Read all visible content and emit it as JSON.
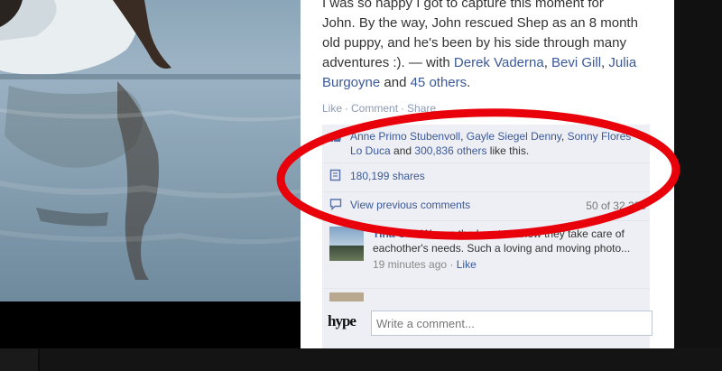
{
  "caption": {
    "line1": "I was so happy I got to capture this moment for",
    "line2": "John. By the way, John rescued Shep as an 8 month",
    "line3": "old puppy, and he's been by his side through many",
    "line4_text": "adventures :). — with ",
    "tag1": "Derek Vaderna",
    "sep1": ", ",
    "tag2": "Bevi Gill",
    "sep2": ", ",
    "tag3": "Julia Burgoyne",
    "and": " and ",
    "others": "45 others",
    "end": "."
  },
  "actions": {
    "like": "Like",
    "comment": "Comment",
    "share": "Share"
  },
  "likes": {
    "person1": "Anne Primo Stubenvoll",
    "sep1": ", ",
    "person2": "Gayle Siegel Denny",
    "sep2": ", ",
    "person3": "Sonny Flores Lo Duca",
    "and": " and ",
    "others": "300,836 others",
    "suffix": " like this."
  },
  "shares": {
    "label": "180,199 shares"
  },
  "previous": {
    "label": "View previous comments",
    "count": "50 of 32,385"
  },
  "comment1": {
    "author": "Tina Cox",
    "text": " Warms the heart to know they take care of eachother's needs. Such a loving and moving photo...",
    "time": "19 minutes ago",
    "like": "Like"
  },
  "composer": {
    "logo_text": "hype",
    "placeholder": "Write a comment..."
  },
  "colors": {
    "link": "#3b5998",
    "annotation": "#e8000b",
    "ufi_bg": "#edeff4"
  }
}
